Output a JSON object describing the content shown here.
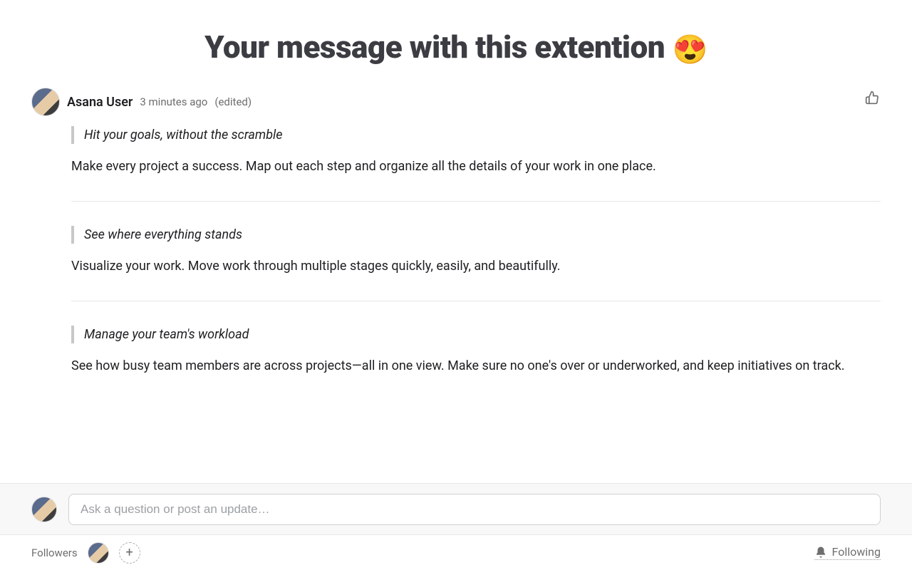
{
  "title": {
    "text": "Your message with this extention ",
    "emoji": "😍"
  },
  "comment": {
    "author": "Asana User",
    "timestamp": "3 minutes ago",
    "edited_label": "(edited)",
    "sections": [
      {
        "quote": "Hit your goals, without the scramble",
        "body": "Make every project a success. Map out each step and organize all the details of your work in one place."
      },
      {
        "quote": "See where everything stands",
        "body": "Visualize your work. Move work through multiple stages quickly, easily, and beautifully."
      },
      {
        "quote": "Manage your team's workload",
        "body": "See how busy team members are across projects—all in one view. Make sure no one's over or underworked, and keep initiatives on track."
      }
    ]
  },
  "compose": {
    "placeholder": "Ask a question or post an update…"
  },
  "followers": {
    "label": "Followers",
    "following_label": "Following"
  }
}
